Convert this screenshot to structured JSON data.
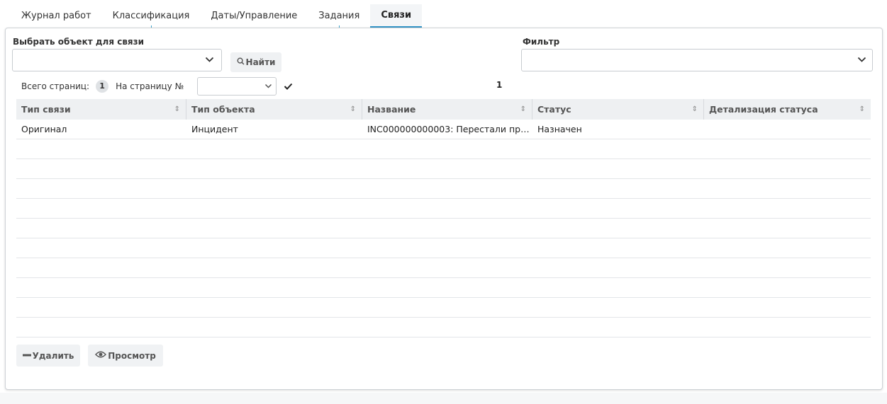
{
  "tabs": [
    {
      "label": "Журнал работ",
      "active": false
    },
    {
      "label": "Классификация",
      "active": false
    },
    {
      "label": "Даты/Управление",
      "active": false
    },
    {
      "label": "Задания",
      "active": false
    },
    {
      "label": "Связи",
      "active": true
    }
  ],
  "link_select": {
    "label": "Выбрать объект для связи",
    "value": "",
    "icon": "chevron-down-icon"
  },
  "find_button": {
    "label": "Найти",
    "icon": "search-icon"
  },
  "filter": {
    "label": "Фильтр",
    "value": "",
    "icon": "chevron-down-icon"
  },
  "pager": {
    "total_pages_label": "Всего страниц:",
    "total_pages": "1",
    "goto_label": "На страницу №",
    "goto_value": "",
    "confirm_icon": "checkmark-icon",
    "current_page": "1"
  },
  "table": {
    "columns": [
      "Тип связи",
      "Тип объекта",
      "Название",
      "Статус",
      "Детализация статуса"
    ],
    "sort_icon": "sort-icon",
    "rows": [
      [
        "Оригинал",
        "Инцидент",
        "INC000000000003: Перестали пр…",
        "Назначен",
        ""
      ],
      [
        "",
        "",
        "",
        "",
        ""
      ],
      [
        "",
        "",
        "",
        "",
        ""
      ],
      [
        "",
        "",
        "",
        "",
        ""
      ],
      [
        "",
        "",
        "",
        "",
        ""
      ],
      [
        "",
        "",
        "",
        "",
        ""
      ],
      [
        "",
        "",
        "",
        "",
        ""
      ],
      [
        "",
        "",
        "",
        "",
        ""
      ],
      [
        "",
        "",
        "",
        "",
        ""
      ],
      [
        "",
        "",
        "",
        "",
        ""
      ],
      [
        "",
        "",
        "",
        "",
        ""
      ]
    ]
  },
  "actions": {
    "delete": {
      "label": "Удалить",
      "icon": "minus-icon"
    },
    "view": {
      "label": "Просмотр",
      "icon": "eye-icon"
    }
  },
  "colors": {
    "accent": "#3495c8",
    "header_bg": "#eef0f2",
    "button_bg": "#f0f2f4"
  }
}
